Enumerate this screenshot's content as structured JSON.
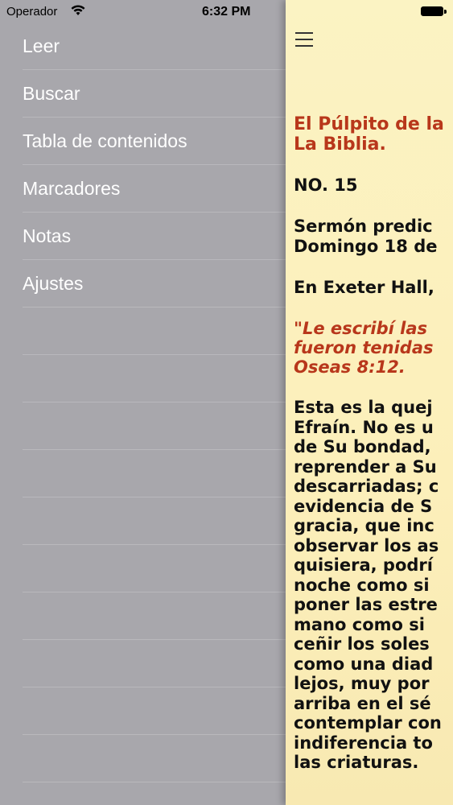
{
  "status_bar": {
    "carrier": "Operador",
    "time": "6:32 PM"
  },
  "menu": {
    "items": [
      {
        "label": "Leer"
      },
      {
        "label": "Buscar"
      },
      {
        "label": "Tabla de contenidos"
      },
      {
        "label": "Marcadores"
      },
      {
        "label": "Notas"
      },
      {
        "label": "Ajustes"
      }
    ]
  },
  "content": {
    "title_line1": "El Púlpito de la",
    "title_line2": "La Biblia.",
    "number": "NO. 15",
    "sermon_line1": "Sermón predic",
    "sermon_line2": "Domingo 18 de",
    "place": "En Exeter Hall,",
    "quote_line1": "\"Le escribí las",
    "quote_line2": "fueron tenidas",
    "quote_line3": "Oseas 8:12.",
    "body_lines": [
      "Esta es la quej",
      "Efraín. No es u",
      "de Su bondad,",
      "reprender a Su",
      "descarriadas; c",
      "evidencia de S",
      "gracia, que inc",
      "observar los as",
      "quisiera, podrí",
      "noche como si",
      "poner las estre",
      "mano como si",
      "ceñir los soles",
      "como una diad",
      "lejos, muy por",
      "arriba en el sé",
      "contemplar con",
      "indiferencia to",
      "las criaturas."
    ]
  },
  "colors": {
    "menu_bg": "#a8a7ac",
    "content_bg": "#fbf3c3",
    "accent_red": "#b8371b"
  }
}
